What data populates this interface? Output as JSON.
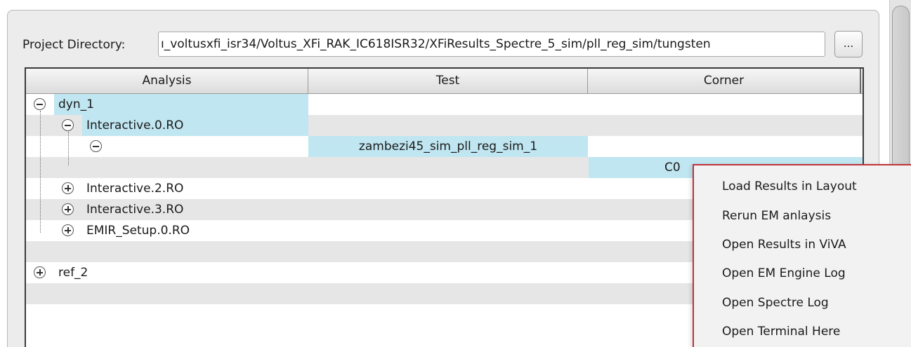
{
  "project": {
    "label": "Project Directory:",
    "value": "ı_voltusxfi_isr34/Voltus_XFi_RAK_IC618ISR32/XFiResults_Spectre_5_sim/pll_reg_sim/tungsten",
    "browse_label": "..."
  },
  "table": {
    "columns": [
      "Analysis",
      "Test",
      "Corner"
    ],
    "rows": [
      {
        "analysis": "dyn_1",
        "toggle": "minus",
        "test": "",
        "corner": ""
      },
      {
        "analysis": "Interactive.0.RO",
        "toggle": "minus",
        "test": "",
        "corner": ""
      },
      {
        "analysis": "",
        "toggle": "minus",
        "test": "zambezi45_sim_pll_reg_sim_1",
        "corner": ""
      },
      {
        "analysis": "",
        "toggle": "",
        "test": "",
        "corner": "C0"
      },
      {
        "analysis": "Interactive.2.RO",
        "toggle": "plus",
        "test": "",
        "corner": ""
      },
      {
        "analysis": "Interactive.3.RO",
        "toggle": "plus",
        "test": "",
        "corner": ""
      },
      {
        "analysis": "EMIR_Setup.0.RO",
        "toggle": "plus",
        "test": "",
        "corner": ""
      },
      {
        "analysis": "",
        "toggle": "",
        "test": "",
        "corner": ""
      },
      {
        "analysis": "ref_2",
        "toggle": "plus",
        "test": "",
        "corner": ""
      }
    ]
  },
  "context_menu": {
    "items": [
      "Load Results in Layout",
      "Rerun EM anlaysis",
      "Open Results in ViVA",
      "Open EM Engine Log",
      "Open Spectre Log",
      "Open Terminal Here"
    ]
  },
  "colors": {
    "selection": "#c0e6f1",
    "menu_border": "#c0323a",
    "alt_row": "#e6e6e6"
  }
}
